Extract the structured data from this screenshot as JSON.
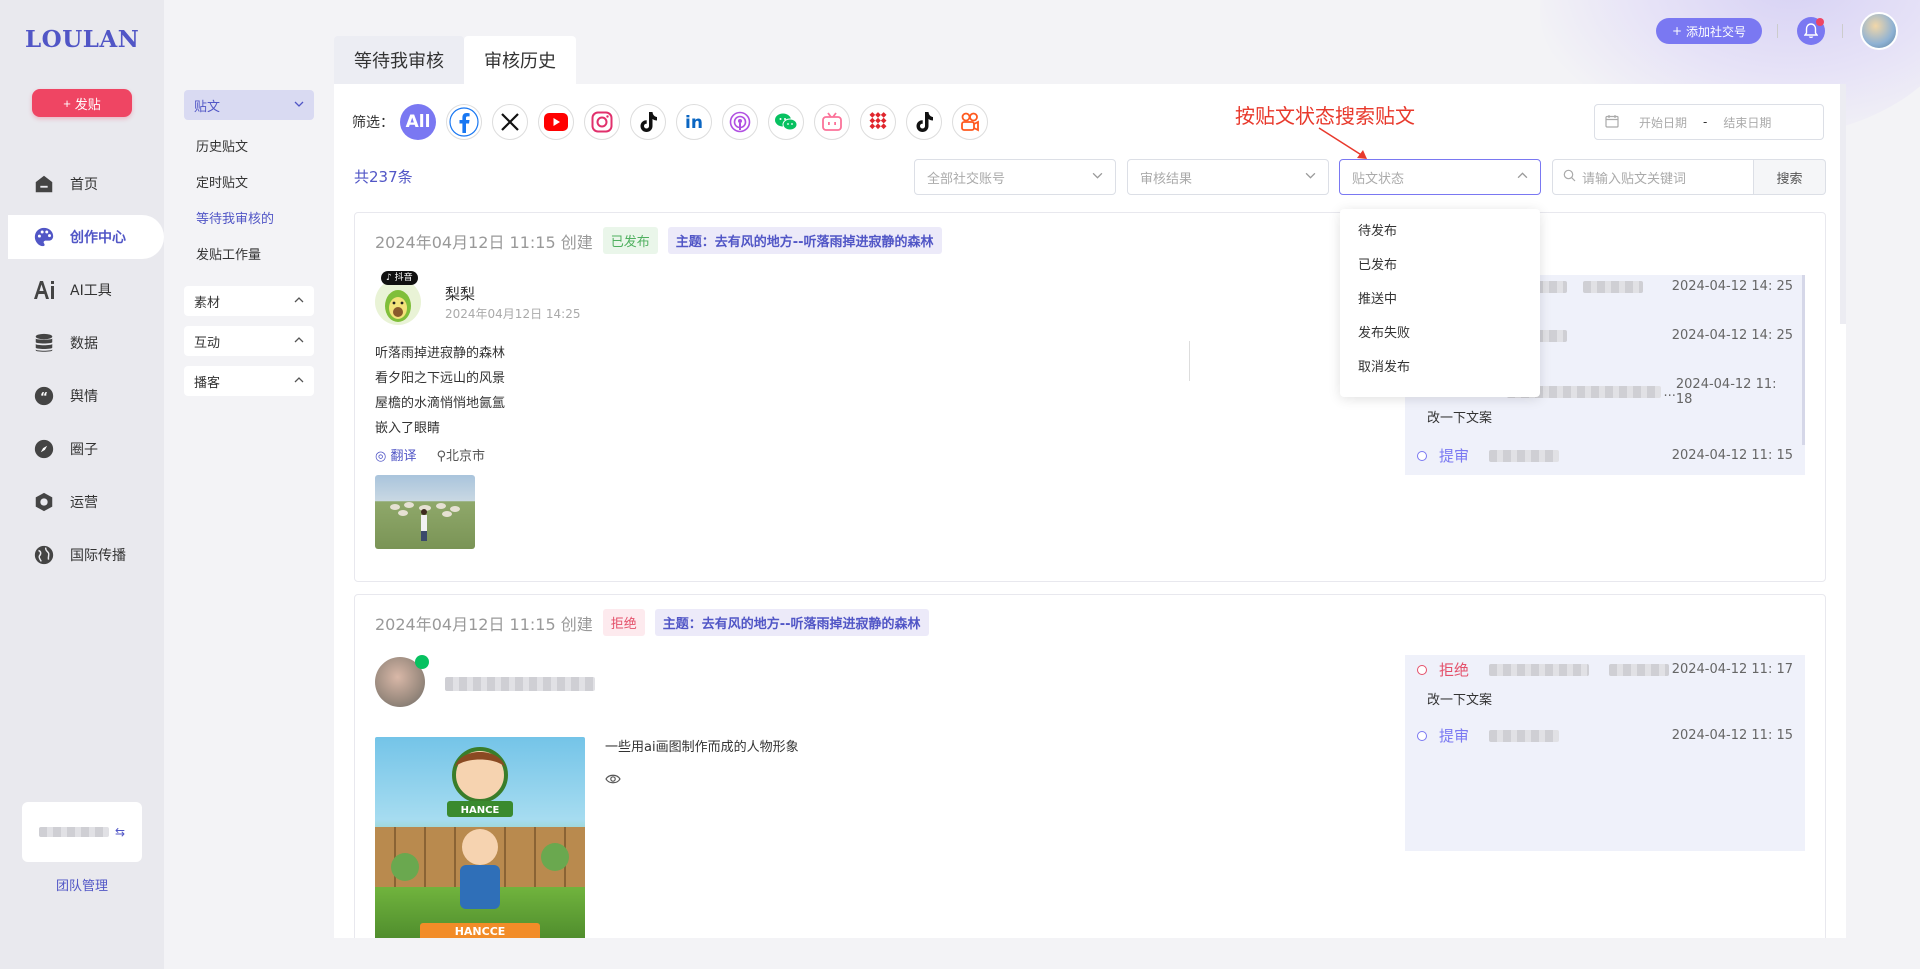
{
  "app": {
    "logo": "LOULAN",
    "post_button": "发贴"
  },
  "sidebar": {
    "items": [
      {
        "label": "首页",
        "icon": "home-icon"
      },
      {
        "label": "创作中心",
        "icon": "palette-icon",
        "active": true
      },
      {
        "label": "AI工具",
        "icon": "ai-icon"
      },
      {
        "label": "数据",
        "icon": "database-icon"
      },
      {
        "label": "舆情",
        "icon": "quote-icon"
      },
      {
        "label": "圈子",
        "icon": "compass-icon"
      },
      {
        "label": "运营",
        "icon": "operation-icon"
      },
      {
        "label": "国际传播",
        "icon": "globe-icon"
      }
    ],
    "team_link": "团队管理"
  },
  "subnav": {
    "group_posts": "贴文",
    "items": [
      "历史贴文",
      "定时贴文",
      "等待我审核的",
      "发贴工作量"
    ],
    "group_material": "素材",
    "group_interact": "互动",
    "group_podcast": "播客"
  },
  "tabs": [
    "等待我审核",
    "审核历史"
  ],
  "filter": {
    "label": "筛选：",
    "platforms": [
      {
        "name": "All",
        "icon": "all-icon"
      },
      {
        "name": "Facebook",
        "icon": "facebook-icon",
        "color": "#1877f2"
      },
      {
        "name": "X",
        "icon": "x-icon",
        "color": "#000000"
      },
      {
        "name": "YouTube",
        "icon": "youtube-icon",
        "color": "#ff0000"
      },
      {
        "name": "Instagram",
        "icon": "instagram-icon",
        "color": "#e1306c"
      },
      {
        "name": "TikTok",
        "icon": "tiktok-icon",
        "color": "#000000"
      },
      {
        "name": "LinkedIn",
        "icon": "linkedin-icon",
        "color": "#0a66c2"
      },
      {
        "name": "Podcast",
        "icon": "podcast-icon",
        "color": "#b150e2"
      },
      {
        "name": "WeChat",
        "icon": "wechat-icon",
        "color": "#07c160"
      },
      {
        "name": "Bilibili",
        "icon": "bilibili-icon",
        "color": "#fb7299"
      },
      {
        "name": "Weibo-pattern",
        "icon": "checker-icon",
        "color": "#e0262d"
      },
      {
        "name": "Douyin",
        "icon": "douyin-icon",
        "color": "#000000"
      },
      {
        "name": "Kuaishou",
        "icon": "kuaishou-icon",
        "color": "#ff5a1f"
      }
    ],
    "date_start": "开始日期",
    "date_sep": "-",
    "date_end": "结束日期",
    "annotation": "按贴文状态搜索贴文",
    "count": "共237条",
    "account_select": "全部社交账号",
    "review_select": "审核结果",
    "status_select": "贴文状态",
    "keyword_placeholder": "请输入贴文关键词",
    "search_button": "搜索"
  },
  "status_dropdown": [
    "待发布",
    "已发布",
    "推送中",
    "发布失败",
    "取消发布"
  ],
  "posts": [
    {
      "created": "2024年04月12日 11:15 创建",
      "status": "已发布",
      "topic": "主题：去有风的地方--听落雨掉进寂静的森林",
      "user": "梨梨",
      "user_time": "2024年04月12日 14:25",
      "platform_tag": "抖音",
      "lines": [
        "听落雨掉进寂静的森林",
        "看夕阳之下远山的风景",
        "屋檐的水滴悄悄地氤氲",
        "嵌入了眼睛"
      ],
      "translate": "翻译",
      "location": "北京市",
      "timeline": [
        {
          "time": "2024-04-12 14: 25"
        },
        {
          "time": "2024-04-12 14: 25"
        },
        {
          "time": "2024-04-12 11: 18"
        },
        {
          "note": "改一下文案"
        },
        {
          "status": "提审",
          "time": "2024-04-12 11: 15"
        }
      ]
    },
    {
      "created": "2024年04月12日 11:15 创建",
      "status": "拒绝",
      "topic": "主题：去有风的地方--听落雨掉进寂静的森林",
      "text": "一些用ai画图制作而成的人物形象",
      "image_caption": "HANCCE",
      "timeline": [
        {
          "status": "拒绝",
          "time": "2024-04-12 11: 17"
        },
        {
          "note": "改一下文案"
        },
        {
          "status": "提审",
          "time": "2024-04-12 11: 15"
        }
      ]
    }
  ],
  "header": {
    "add_social": "添加社交号"
  },
  "colors": {
    "accent": "#7a78f2",
    "brand": "#5156c6",
    "danger": "#ef4563",
    "annotation": "#e8392c"
  }
}
